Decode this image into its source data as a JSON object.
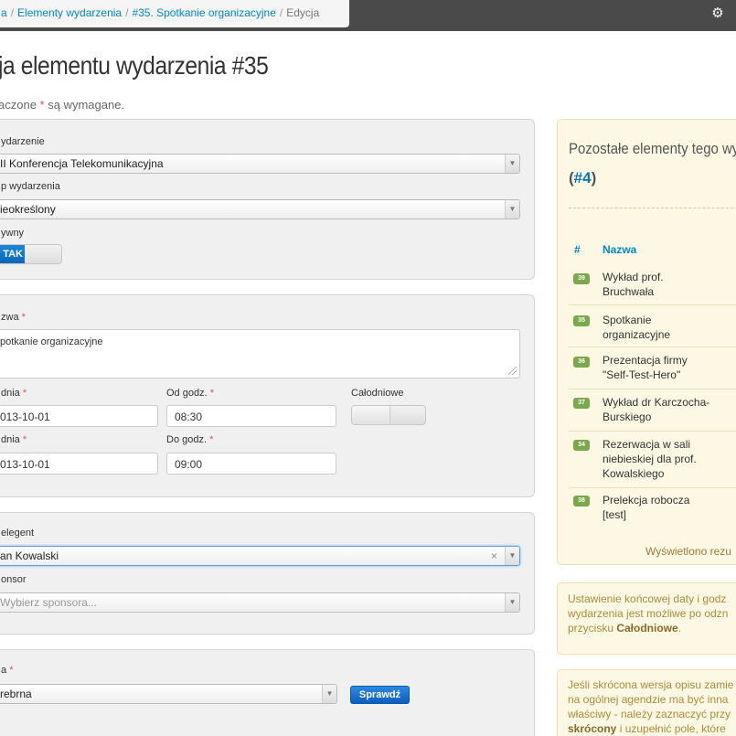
{
  "breadcrumb": {
    "items": [
      "a",
      "Elementy wydarzenia",
      "#35. Spotkanie organizacyjne"
    ],
    "active": "Edycja",
    "separator": "/"
  },
  "page": {
    "title": "ja elementu wydarzenia #35",
    "required_note_prefix": "aczone ",
    "required_star": "*",
    "required_note_suffix": " są wymagane."
  },
  "form": {
    "event": {
      "label": "ydarzenie",
      "value": "II Konferencja Telekomunikacyjna"
    },
    "type": {
      "label": "p wydarzenia",
      "value": "ieokreślony"
    },
    "active": {
      "label": "ywny",
      "value": "TAK"
    },
    "name": {
      "label": "zwa",
      "star": "*",
      "value": "potkanie organizacyjne"
    },
    "date_from": {
      "label": "dnia",
      "star": "*",
      "value": "013-10-01"
    },
    "time_from": {
      "label": "Od godz.",
      "star": "*",
      "value": "08:30"
    },
    "all_day": {
      "label": "Całodniowe"
    },
    "date_to": {
      "label": "dnia",
      "star": "*",
      "value": "013-10-01"
    },
    "time_to": {
      "label": "Do godz.",
      "star": "*",
      "value": "09:00"
    },
    "delegate": {
      "label": "elegent",
      "value": "an Kowalski",
      "clear": "×"
    },
    "sponsor": {
      "label": "onsor",
      "placeholder": "Wybierz sponsora..."
    },
    "room": {
      "label": "a",
      "star": "*",
      "value": "rebrna",
      "check_button": "Sprawdź"
    }
  },
  "sidebar": {
    "title": "Pozostałe elementy tego wy",
    "count_open": "(",
    "count": "#4",
    "count_close": ")",
    "col_number": "#",
    "col_name": "Nazwa",
    "events": [
      {
        "id": "39",
        "line1": "Wykład prof.",
        "line2": "Bruchwała"
      },
      {
        "id": "35",
        "line1": "Spotkanie",
        "line2": "organizacyjne"
      },
      {
        "id": "36",
        "line1": "Prezentacja firmy",
        "line2": "\"Self-Test-Hero\""
      },
      {
        "id": "37",
        "line1": "Wykład dr Karczocha-",
        "line2": "Burskiego"
      },
      {
        "id": "34",
        "line1": "Rezerwacja w sali",
        "line2": "niebieskiej dla prof.",
        "line3": "Kowalskiego"
      },
      {
        "id": "38",
        "line1": "Prelekcja robocza",
        "line2": "[test]"
      }
    ],
    "footer": "Wyświetlono rezu"
  },
  "notes": {
    "allday": {
      "line1": "Ustawienie końcowej daty i godz",
      "line2": "wydarzenia jest możliwe po odzn",
      "line3_prefix": "przycisku ",
      "line3_bold": "Całodniowe",
      "line3_suffix": "."
    },
    "short": {
      "line1": "Jeśli skrócona wersja opisu zamie",
      "line2": "na ogólnej agendzie ma być inna",
      "line3": "właściwy - należy zaznaczyć przy",
      "line4_bold": "skrócony",
      "line4_suffix": " i uzupełnić pole, które"
    }
  },
  "colors": {
    "topbar": "#4a4a4a",
    "link": "#0088cc",
    "required": "#d9534f",
    "badge": "#7ba84a",
    "toggle_on": "#0a67b6"
  }
}
